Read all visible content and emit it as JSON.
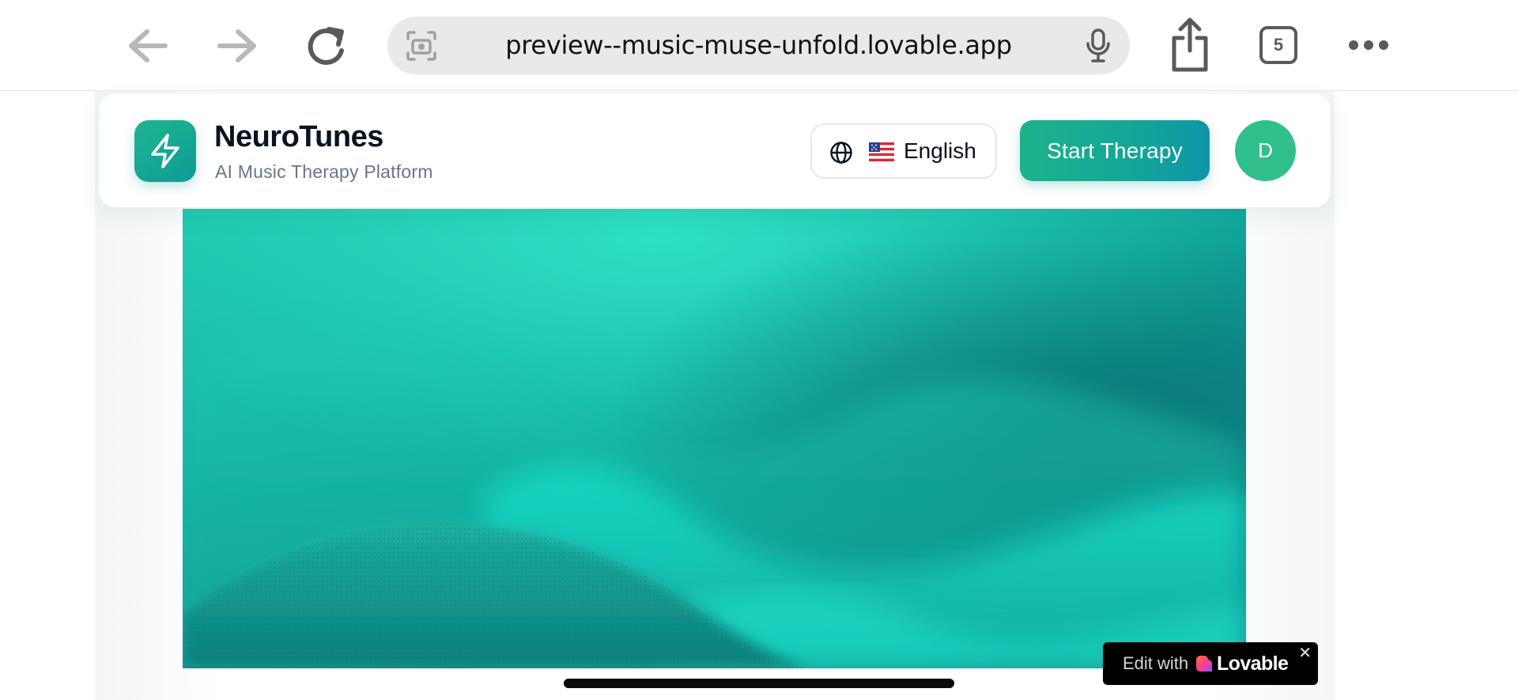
{
  "browser": {
    "url": "preview--music-muse-unfold.lovable.app",
    "tab_count": "5",
    "icons": {
      "back": "back-arrow-icon",
      "forward": "forward-arrow-icon",
      "reload": "reload-icon",
      "lens": "visual-search-icon",
      "mic": "microphone-icon",
      "share": "share-icon",
      "more": "more-icon"
    }
  },
  "header": {
    "brand_name": "NeuroTunes",
    "tagline": "AI Music Therapy Platform",
    "logo_icon": "lightning-bolt-icon",
    "language": {
      "icon": "globe-icon",
      "flag": "🇺🇸",
      "label": "English"
    },
    "cta_label": "Start Therapy",
    "avatar_initial": "D"
  },
  "hero": {
    "image": "teal abstract wave",
    "colors": {
      "light": "#2fe0c4",
      "mid": "#14b8a9",
      "deep": "#0a7a7e"
    }
  },
  "badge": {
    "edit_text": "Edit with",
    "brand": "Lovable",
    "close": "✕"
  },
  "colors": {
    "accent": "#1eb28c",
    "accent_end": "#0f96a8",
    "avatar": "#2fc08b",
    "text_dark": "#0b1220",
    "text_muted": "#6b7488"
  }
}
